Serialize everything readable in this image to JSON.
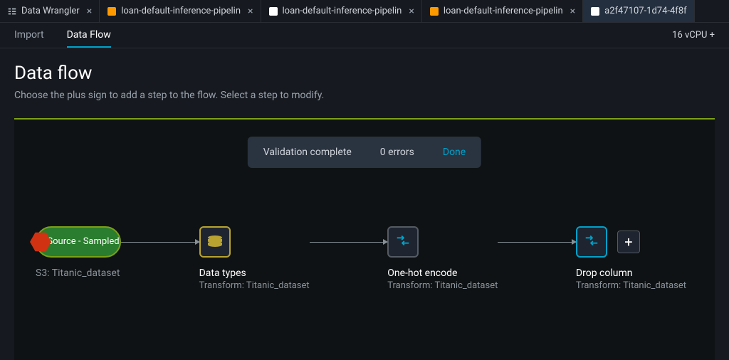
{
  "tabs": [
    {
      "label": "Data Wrangler",
      "icon": "wrangler",
      "closable": true,
      "active": false
    },
    {
      "label": "loan-default-inference-pipelin",
      "icon": "orange",
      "closable": true,
      "active": false
    },
    {
      "label": "loan-default-inference-pipelin",
      "icon": "white",
      "closable": true,
      "active": false
    },
    {
      "label": "loan-default-inference-pipelin",
      "icon": "orange",
      "closable": true,
      "active": false
    },
    {
      "label": "a2f47107-1d74-4f8f",
      "icon": "white",
      "closable": false,
      "active": true
    }
  ],
  "subnav": {
    "items": [
      {
        "label": "Import",
        "active": false
      },
      {
        "label": "Data Flow",
        "active": true
      }
    ],
    "status": "16 vCPU +"
  },
  "header": {
    "title": "Data flow",
    "subtitle": "Choose the plus sign to add a step to the flow. Select a step to modify."
  },
  "toast": {
    "message": "Validation complete",
    "errors": "0 errors",
    "action": "Done"
  },
  "flow": {
    "nodes": [
      {
        "id": "source",
        "title": "Source - Sampled",
        "label": "S3: Titanic_dataset",
        "sublabel": ""
      },
      {
        "id": "datatypes",
        "title": "",
        "label": "Data types",
        "sublabel": "Transform: Titanic_dataset"
      },
      {
        "id": "onehot",
        "title": "",
        "label": "One-hot encode",
        "sublabel": "Transform: Titanic_dataset"
      },
      {
        "id": "drop",
        "title": "",
        "label": "Drop column",
        "sublabel": "Transform: Titanic_dataset",
        "selected": true
      }
    ],
    "add_label": "+"
  }
}
